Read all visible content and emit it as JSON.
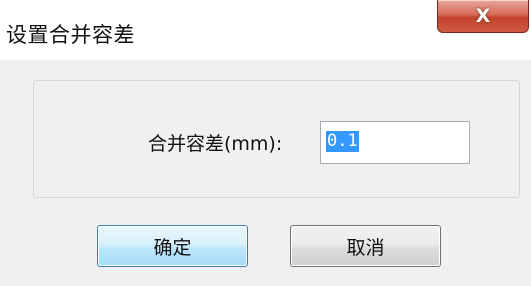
{
  "window": {
    "title": "设置合并容差",
    "close_icon": "close-icon",
    "close_glyph": "X"
  },
  "form": {
    "tolerance_label": "合并容差(mm):",
    "tolerance_value": "0.1"
  },
  "buttons": {
    "ok_label": "确定",
    "cancel_label": "取消"
  },
  "colors": {
    "dialog_background": "#f0f0f0",
    "close_button": "#c2412a",
    "selection": "#3399ff",
    "ok_border": "#3c7fb1"
  }
}
